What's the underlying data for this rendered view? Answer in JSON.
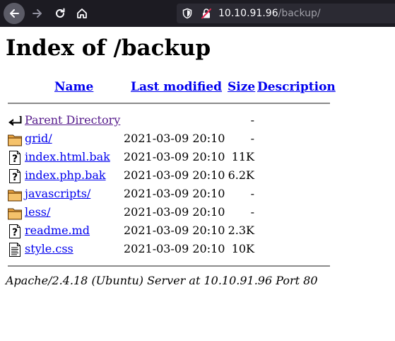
{
  "browser": {
    "url_host": "10.10.91.96",
    "url_path": "/backup/",
    "icons": [
      "back-arrow-icon",
      "forward-arrow-icon",
      "reload-icon",
      "home-icon",
      "shield-icon",
      "insecure-lock-icon"
    ]
  },
  "page": {
    "title": "Index of /backup",
    "columns": {
      "name": "Name",
      "last_modified": "Last modified",
      "size": "Size",
      "description": "Description"
    },
    "rows": [
      {
        "icon": "back-icon",
        "name": "Parent Directory",
        "modified": "",
        "size": "-"
      },
      {
        "icon": "folder-icon",
        "name": "grid/",
        "modified": "2021-03-09 20:10",
        "size": "-"
      },
      {
        "icon": "unknown-file-icon",
        "name": "index.html.bak",
        "modified": "2021-03-09 20:10",
        "size": "11K"
      },
      {
        "icon": "unknown-file-icon",
        "name": "index.php.bak",
        "modified": "2021-03-09 20:10",
        "size": "6.2K"
      },
      {
        "icon": "folder-icon",
        "name": "javascripts/",
        "modified": "2021-03-09 20:10",
        "size": "-"
      },
      {
        "icon": "folder-icon",
        "name": "less/",
        "modified": "2021-03-09 20:10",
        "size": "-"
      },
      {
        "icon": "unknown-file-icon",
        "name": "readme.md",
        "modified": "2021-03-09 20:10",
        "size": "2.3K"
      },
      {
        "icon": "text-file-icon",
        "name": "style.css",
        "modified": "2021-03-09 20:10",
        "size": "10K"
      }
    ],
    "footer": "Apache/2.4.18 (Ubuntu) Server at 10.10.91.96 Port 80"
  },
  "colors": {
    "link": "#0000ee",
    "visited": "#551a8b",
    "toolbar": "#1c1b22",
    "urlbar": "#2b2a33"
  }
}
